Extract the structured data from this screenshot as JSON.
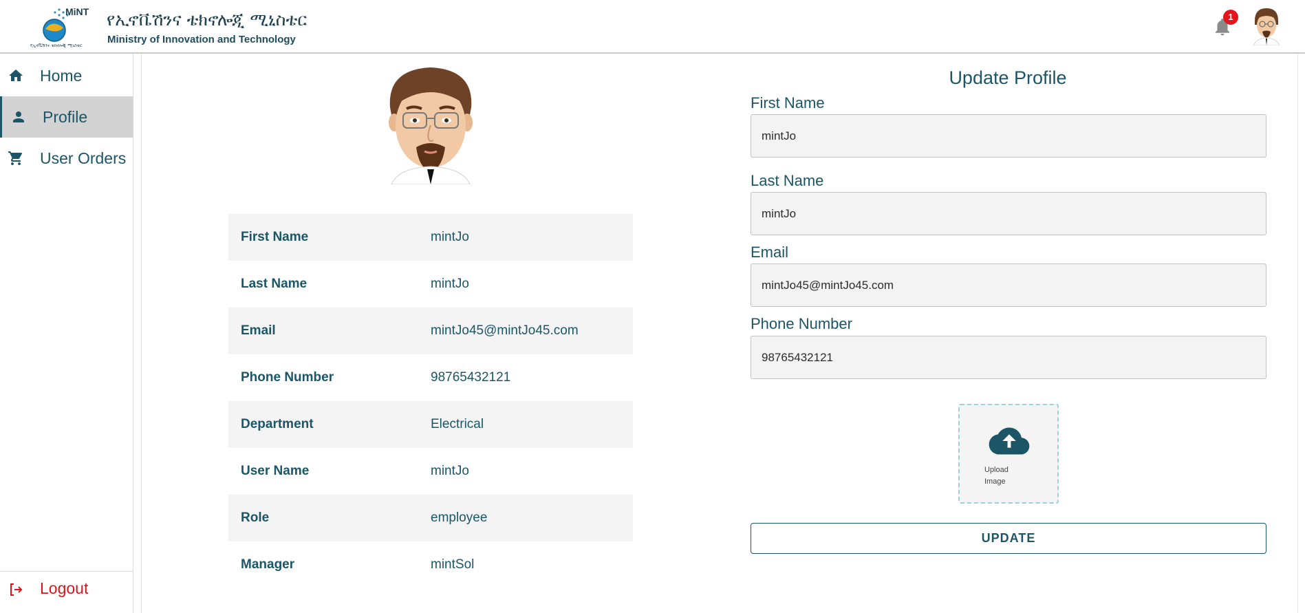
{
  "header": {
    "logo_text": "MiNT",
    "logo_subtext": "የኢኖቬሽንና ቴክኖሎጂ ሚኒስቴር",
    "org_amharic": "የኢኖቬሽንና ቴክኖሎጂ ሚኒስቴር",
    "org_english": "Ministry of Innovation and Technology",
    "notification_count": "1",
    "notification_icon": "bell-icon",
    "avatar_icon": "user-avatar"
  },
  "sidebar": {
    "items": [
      {
        "label": "Home",
        "icon": "home-icon",
        "active": false
      },
      {
        "label": "Profile",
        "icon": "person-icon",
        "active": true
      },
      {
        "label": "User Orders",
        "icon": "cart-icon",
        "active": false
      }
    ],
    "logout_label": "Logout",
    "logout_icon": "logout-icon"
  },
  "profile": {
    "rows": [
      {
        "key": "First Name",
        "value": "mintJo"
      },
      {
        "key": "Last Name",
        "value": "mintJo"
      },
      {
        "key": "Email",
        "value": "mintJo45@mintJo45.com"
      },
      {
        "key": "Phone Number",
        "value": "98765432121"
      },
      {
        "key": "Department",
        "value": "Electrical"
      },
      {
        "key": "User Name",
        "value": "mintJo"
      },
      {
        "key": "Role",
        "value": "employee"
      },
      {
        "key": "Manager",
        "value": "mintSol"
      }
    ]
  },
  "form": {
    "title": "Update Profile",
    "fields": [
      {
        "label": "First Name",
        "value": "mintJo"
      },
      {
        "label": "Last Name",
        "value": "mintJo"
      },
      {
        "label": "Email",
        "value": "mintJo45@mintJo45.com"
      },
      {
        "label": "Phone Number",
        "value": "98765432121"
      }
    ],
    "upload_line1": "Upload",
    "upload_line2": "Image",
    "upload_icon": "cloud-upload-icon",
    "update_label": "UPDATE"
  },
  "colors": {
    "primary": "#1b5566",
    "active_bg": "#d3d3d3",
    "danger": "#e0121b",
    "badge": "#e5141d",
    "field_bg": "#f3f3f3",
    "upload_border": "#9dd0da"
  }
}
